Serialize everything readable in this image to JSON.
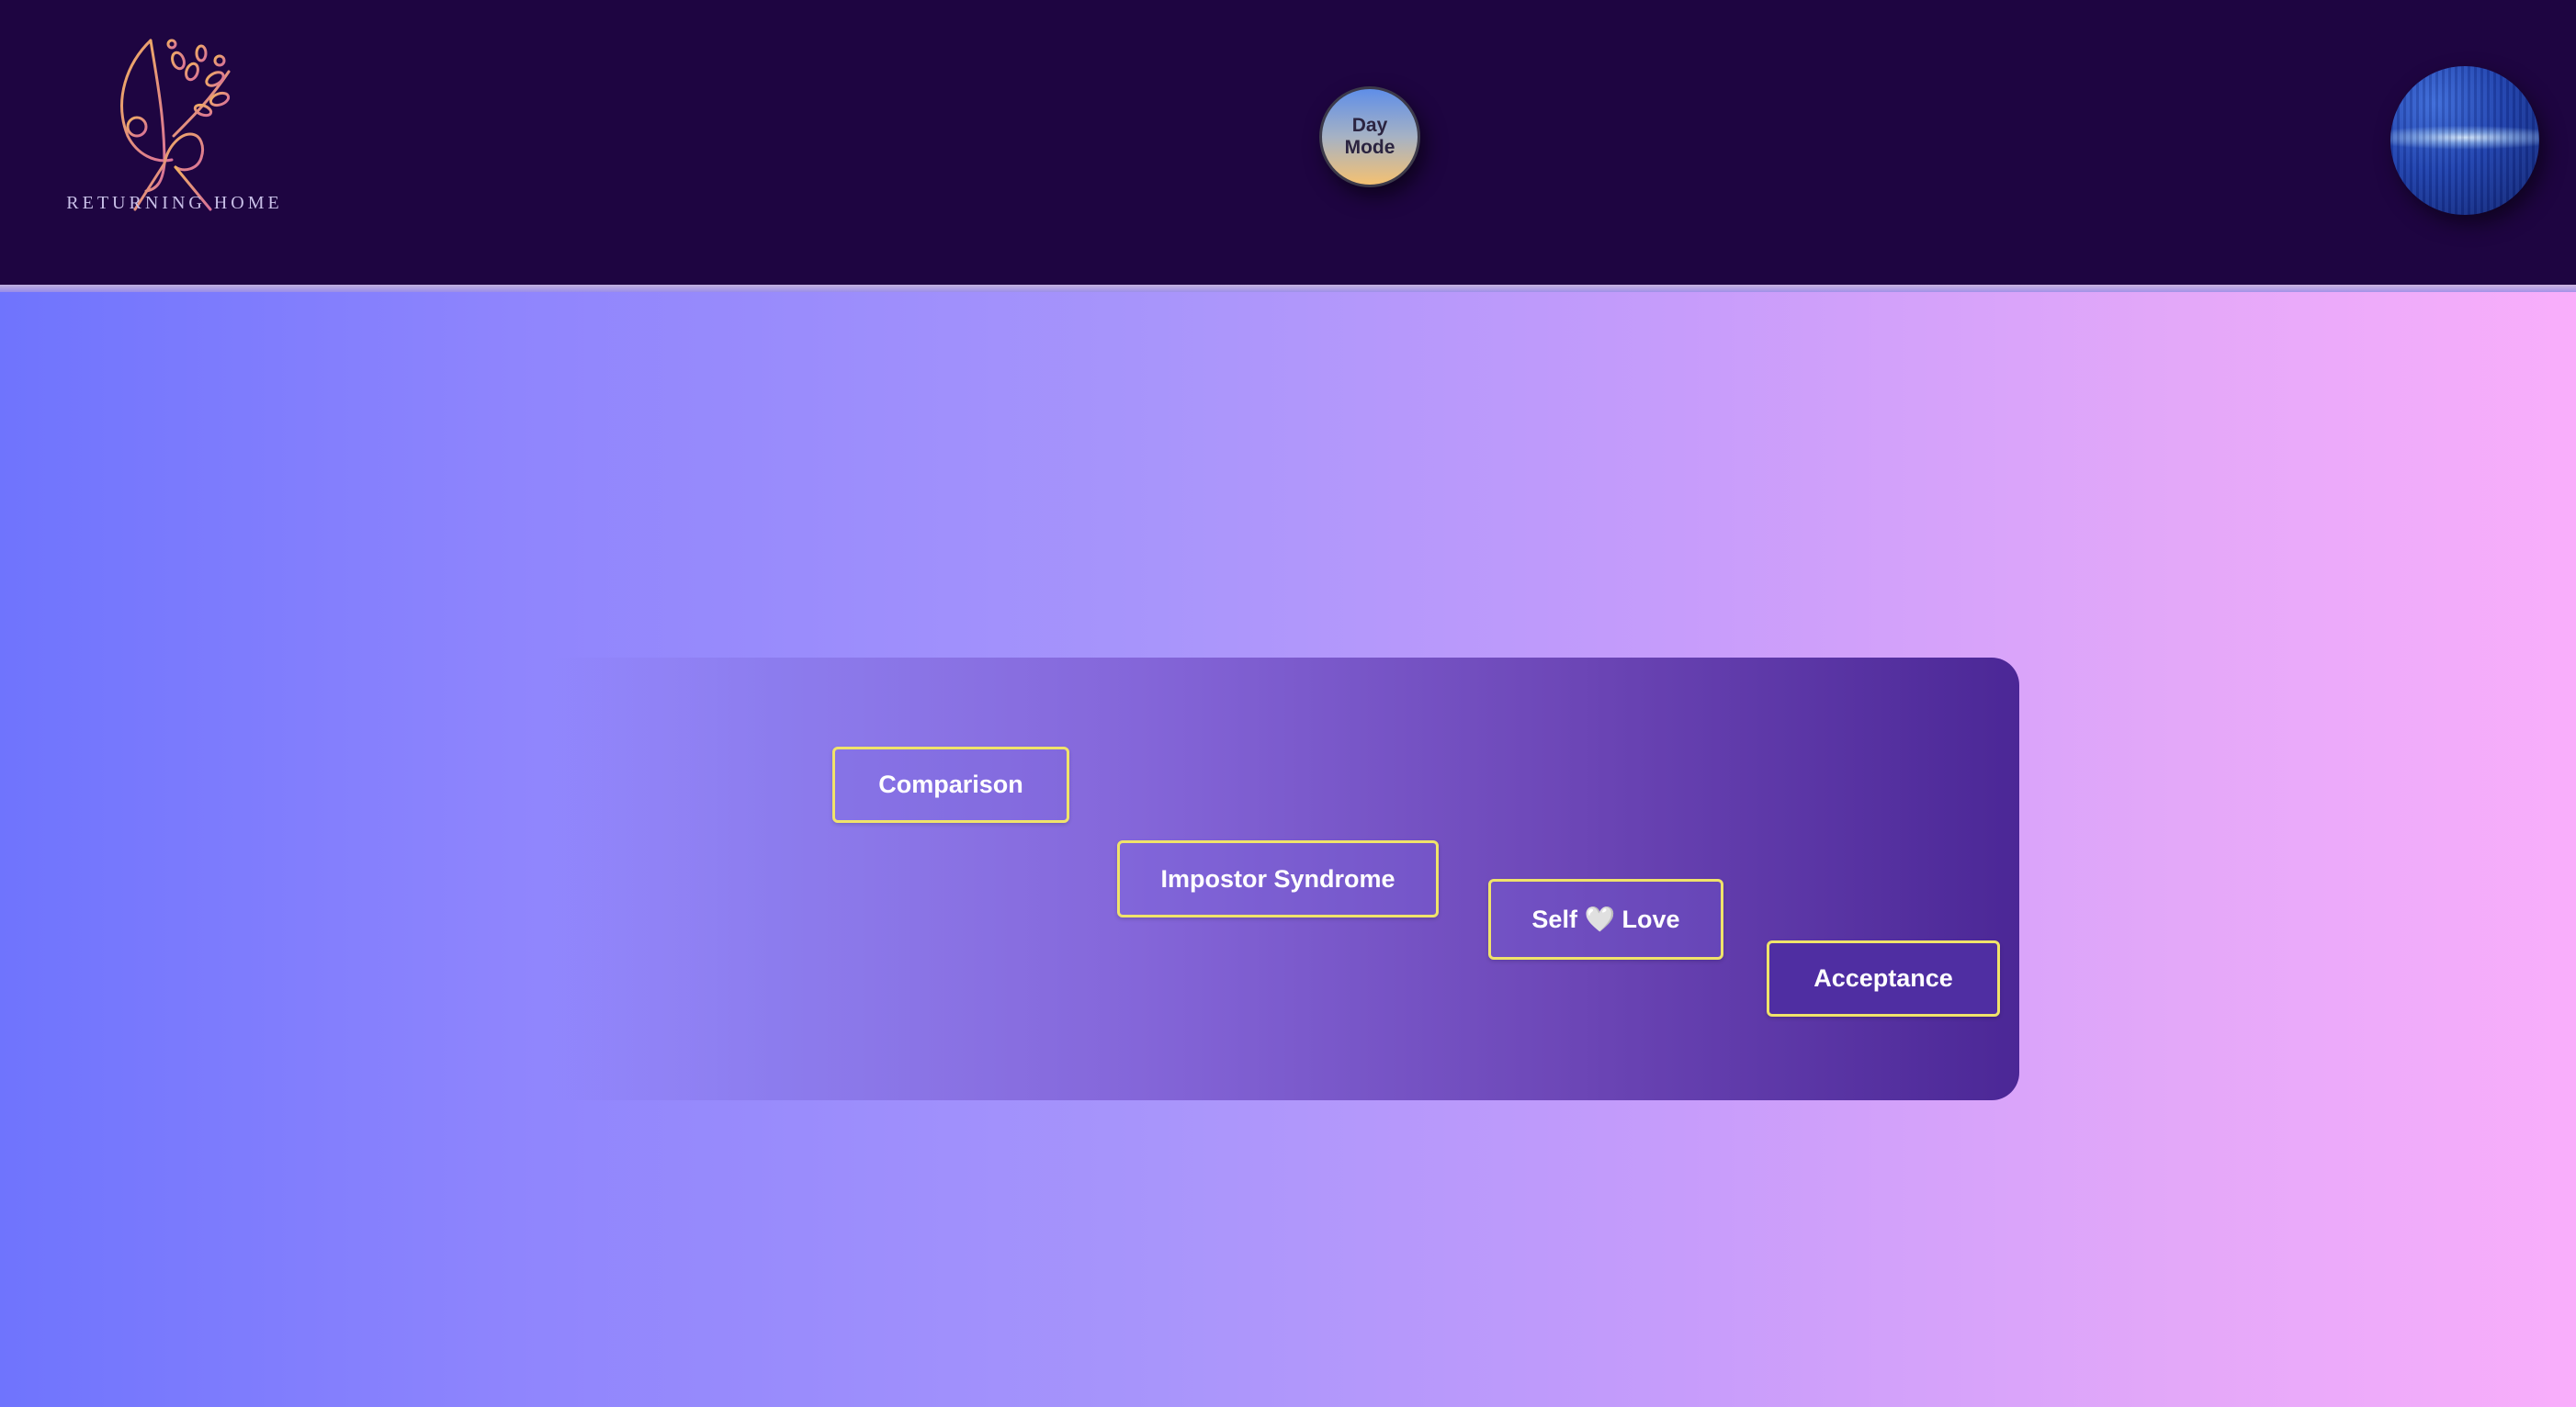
{
  "header": {
    "brand_name": "RETURNING HOME",
    "logo_icon": "flourish-figure-logo-icon",
    "mode_toggle_label": "Day Mode",
    "planet_icon": "blue-planet-icon"
  },
  "topics": [
    {
      "label": "Comparison"
    },
    {
      "label": "Impostor Syndrome"
    },
    {
      "label": "Self 🤍 Love"
    },
    {
      "label": "Acceptance"
    }
  ],
  "colors": {
    "header_bg": "#1e0541",
    "button_border": "#f0e36a",
    "logo_stroke": "#e8a06a",
    "gradient_start": "#6f74fd",
    "gradient_end": "#f9aefb"
  }
}
